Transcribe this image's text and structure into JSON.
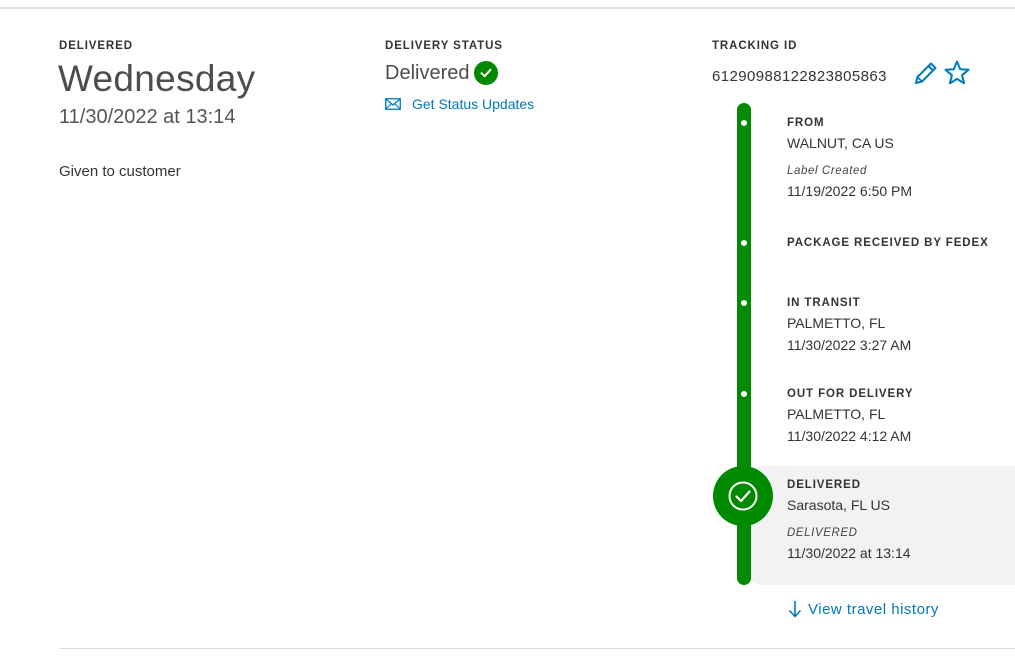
{
  "summary": {
    "label": "DELIVERED",
    "day": "Wednesday",
    "datetime": "11/30/2022 at 13:14",
    "description": "Given to customer"
  },
  "status": {
    "label": "DELIVERY STATUS",
    "value": "Delivered",
    "updates_link": "Get Status Updates",
    "icon": "check-circle-icon"
  },
  "tracking": {
    "label": "TRACKING ID",
    "number": "612909881228238058​63"
  },
  "timeline": {
    "from": {
      "title": "FROM",
      "location": "WALNUT, CA US",
      "sub": "Label Created",
      "time": "11/19/2022 6:50 PM"
    },
    "received": {
      "title": "PACKAGE RECEIVED BY FEDEX"
    },
    "transit": {
      "title": "IN TRANSIT",
      "location": "PALMETTO, FL",
      "time": "11/30/2022 3:27 AM"
    },
    "out": {
      "title": "OUT FOR DELIVERY",
      "location": "PALMETTO, FL",
      "time": "11/30/2022 4:12 AM"
    },
    "delivered": {
      "title": "DELIVERED",
      "location": "Sarasota, FL US",
      "sub": "DELIVERED",
      "time": "11/30/2022 at 13:14"
    }
  },
  "history_link": "View travel history",
  "colors": {
    "green": "#008a00",
    "link": "#007ab7",
    "highlight": "#f2f2f2"
  }
}
